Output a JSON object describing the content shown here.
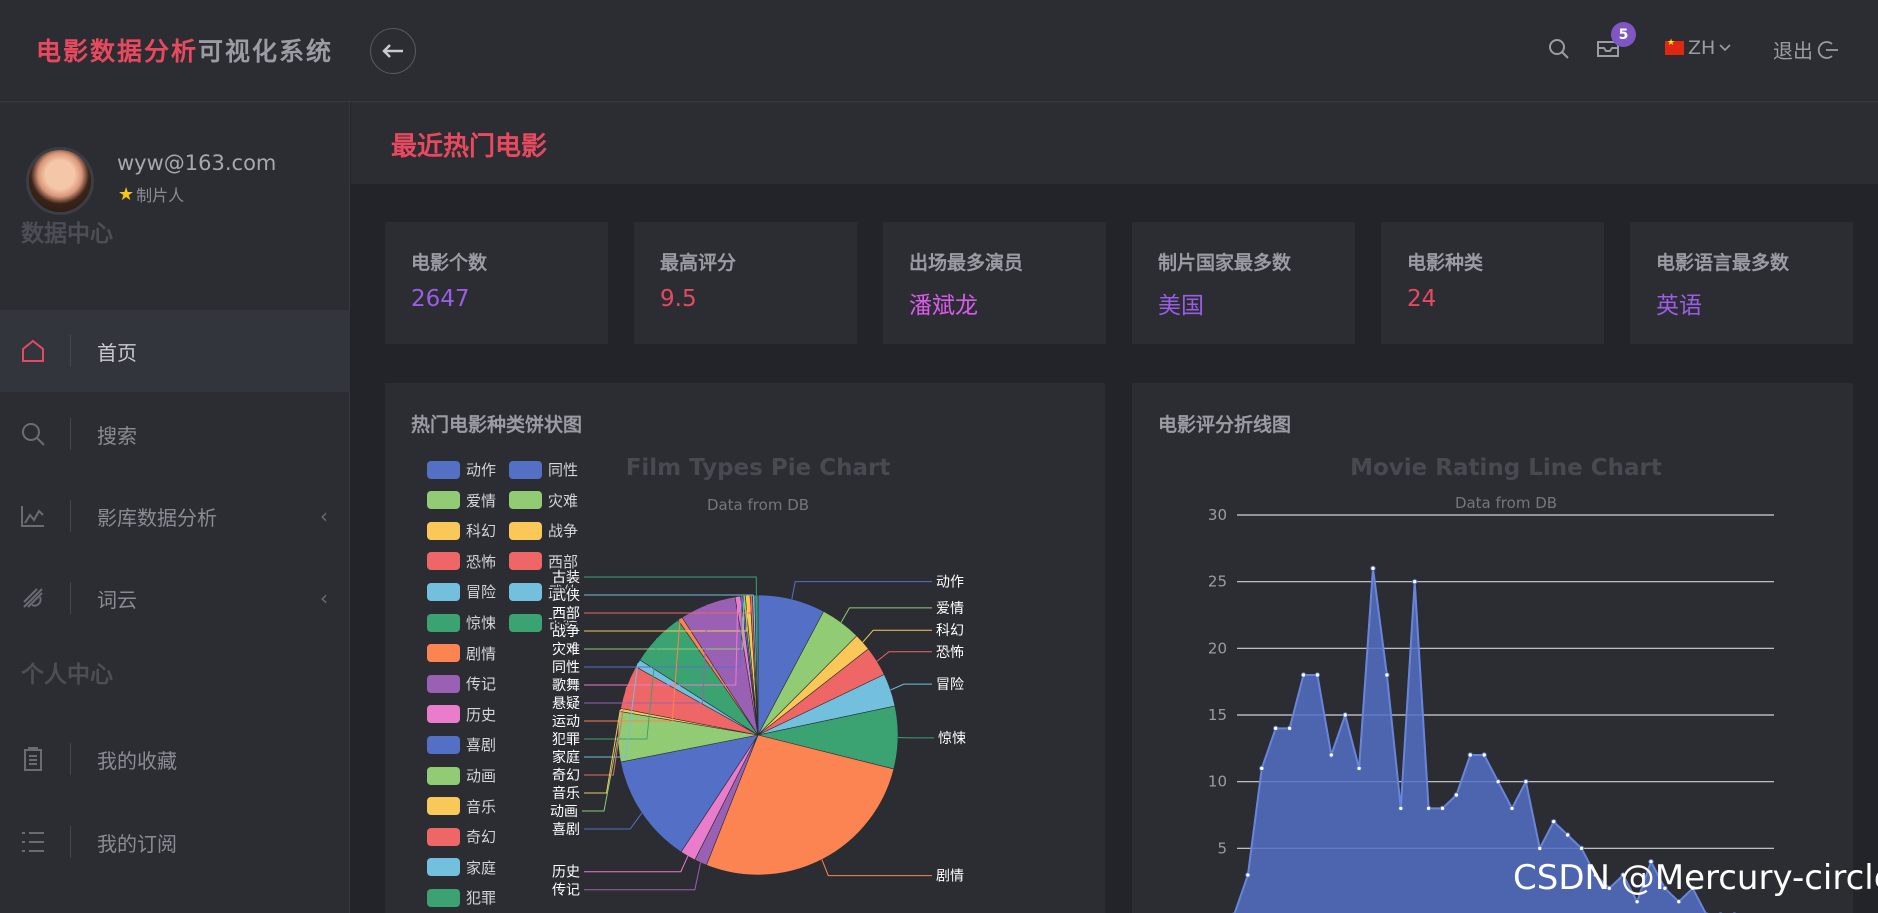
{
  "app": {
    "title_part1": "电影数据分析",
    "title_part2": "可视化系统"
  },
  "header": {
    "notification_count": "5",
    "language": "ZH",
    "logout_label": "退出"
  },
  "user": {
    "email": "wyw@163.com",
    "role": "制片人"
  },
  "sidebar": {
    "section_data": "数据中心",
    "section_personal": "个人中心",
    "items": [
      {
        "label": "首页",
        "icon": "home-icon",
        "active": true
      },
      {
        "label": "搜索",
        "icon": "search-icon"
      },
      {
        "label": "影库数据分析",
        "icon": "chart-line-icon",
        "expandable": true
      },
      {
        "label": "词云",
        "icon": "cloud-icon",
        "expandable": true
      },
      {
        "label": "我的收藏",
        "icon": "clipboard-icon"
      },
      {
        "label": "我的订阅",
        "icon": "list-icon"
      }
    ]
  },
  "page": {
    "title": "最近热门电影"
  },
  "stats": [
    {
      "label": "电影个数",
      "value": "2647",
      "color": "#9b5de5"
    },
    {
      "label": "最高评分",
      "value": "9.5",
      "color": "#e8495e"
    },
    {
      "label": "出场最多演员",
      "value": "潘斌龙",
      "color": "#d95ce8"
    },
    {
      "label": "制片国家最多数",
      "value": "美国",
      "color": "#9b5de5"
    },
    {
      "label": "电影种类",
      "value": "24",
      "color": "#e8495e"
    },
    {
      "label": "电影语言最多数",
      "value": "英语",
      "color": "#9b5de5"
    }
  ],
  "panels": {
    "pie_title": "热门电影种类饼状图",
    "line_title": "电影评分折线图"
  },
  "watermark": "CSDN @Mercury-circle",
  "chart_data": [
    {
      "type": "pie",
      "title": "Film Types Pie Chart",
      "subtitle": "Data from DB",
      "legend": [
        "动作",
        "爱情",
        "科幻",
        "恐怖",
        "冒险",
        "惊悚",
        "剧情",
        "传记",
        "历史",
        "喜剧",
        "动画",
        "音乐",
        "奇幻",
        "家庭",
        "犯罪",
        "同性",
        "灾难",
        "战争",
        "西部",
        "武侠",
        "古装"
      ],
      "slices": [
        {
          "name": "动作",
          "value": 86,
          "color": "#5470c6"
        },
        {
          "name": "爱情",
          "value": 52,
          "color": "#91cc75"
        },
        {
          "name": "科幻",
          "value": 22,
          "color": "#fac858"
        },
        {
          "name": "恐怖",
          "value": 38,
          "color": "#ee6666"
        },
        {
          "name": "冒险",
          "value": 42,
          "color": "#73c0de"
        },
        {
          "name": "惊悚",
          "value": 80,
          "color": "#3ba272"
        },
        {
          "name": "剧情",
          "value": 300,
          "color": "#fc8452"
        },
        {
          "name": "传记",
          "value": 16,
          "color": "#9a60b4"
        },
        {
          "name": "历史",
          "value": 20,
          "color": "#ea7ccc"
        },
        {
          "name": "喜剧",
          "value": 140,
          "color": "#5470c6"
        },
        {
          "name": "动画",
          "value": 64,
          "color": "#91cc75"
        },
        {
          "name": "音乐",
          "value": 4,
          "color": "#fac858"
        },
        {
          "name": "奇幻",
          "value": 56,
          "color": "#ee6666"
        },
        {
          "name": "家庭",
          "value": 10,
          "color": "#73c0de"
        },
        {
          "name": "犯罪",
          "value": 70,
          "color": "#3ba272"
        },
        {
          "name": "运动",
          "value": 6,
          "color": "#fc8452"
        },
        {
          "name": "悬疑",
          "value": 72,
          "color": "#9a60b4"
        },
        {
          "name": "歌舞",
          "value": 7,
          "color": "#ea7ccc"
        },
        {
          "name": "同性",
          "value": 3,
          "color": "#5470c6"
        },
        {
          "name": "灾难",
          "value": 3,
          "color": "#91cc75"
        },
        {
          "name": "战争",
          "value": 6,
          "color": "#fac858"
        },
        {
          "name": "西部",
          "value": 3,
          "color": "#ee6666"
        },
        {
          "name": "武侠",
          "value": 3,
          "color": "#73c0de"
        },
        {
          "name": "古装",
          "value": 4,
          "color": "#3ba272"
        }
      ],
      "label_order": [
        "动作",
        "爱情",
        "科幻",
        "恐怖",
        "冒险",
        "惊悚",
        "剧情",
        "传记",
        "历史",
        "喜剧",
        "动画",
        "音乐",
        "奇幻",
        "家庭",
        "犯罪",
        "运动",
        "悬疑",
        "歌舞",
        "同性",
        "灾难",
        "战争",
        "西部",
        "武侠",
        "古装"
      ]
    },
    {
      "type": "area",
      "title": "Movie Rating Line Chart",
      "subtitle": "Data from DB",
      "ylim": [
        0,
        30
      ],
      "y_ticks": [
        5,
        10,
        15,
        20,
        25,
        30
      ],
      "color": "#5470c6",
      "values": [
        0,
        3,
        11,
        14,
        14,
        18,
        18,
        12,
        15,
        11,
        26,
        18,
        8,
        25,
        8,
        8,
        9,
        12,
        12,
        10,
        8,
        10,
        5,
        7,
        6,
        5,
        3,
        2,
        3,
        1,
        4,
        2,
        1,
        2,
        0,
        0,
        0
      ]
    }
  ]
}
